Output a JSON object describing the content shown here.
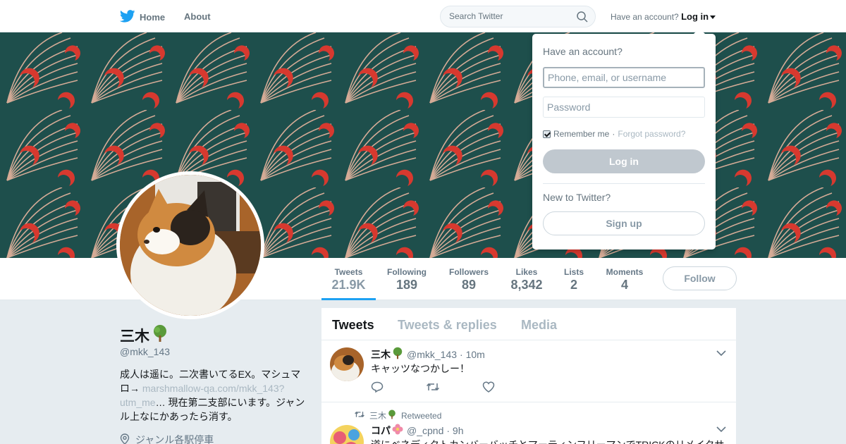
{
  "nav": {
    "home_label": "Home",
    "about_label": "About",
    "search_placeholder": "Search Twitter",
    "have_account": "Have an account?",
    "login_label": "Log in",
    "brand_color": "#1da1f2"
  },
  "profile_nav": {
    "stats": [
      {
        "label": "Tweets",
        "value": "21.9K",
        "active": true
      },
      {
        "label": "Following",
        "value": "189"
      },
      {
        "label": "Followers",
        "value": "89"
      },
      {
        "label": "Likes",
        "value": "8,342"
      },
      {
        "label": "Lists",
        "value": "2"
      },
      {
        "label": "Moments",
        "value": "4"
      }
    ],
    "follow_label": "Follow"
  },
  "profile": {
    "name": "三木",
    "name_emoji": "tree-emoji",
    "handle": "@mkk_143",
    "bio_text_1": "成人は遥に。二次書いてるEX。マシュマロ→ ",
    "bio_link": "marshmallow-qa.com/mkk_143?utm_me",
    "bio_text_2": "… 現在第二支部にいます。ジャンル上なにかあったら消す。",
    "location": "ジャンル各駅停車"
  },
  "timeline": {
    "tabs": [
      "Tweets",
      "Tweets & replies",
      "Media"
    ],
    "tweets": [
      {
        "name": "三木",
        "handle": "@mkk_143",
        "time": "· 10m",
        "text": "キャッツなつかしー！"
      },
      {
        "retweeted_by": "三木",
        "retweeted_label": "Retweeted",
        "name": "コパ",
        "handle": "@_cpnd",
        "time": "· 9h",
        "text": "道にベネディクトカンバーバッチとマーティンフリーマンでTRICKのリメイクサ"
      }
    ]
  },
  "login_dropdown": {
    "title": "Have an account?",
    "username_placeholder": "Phone, email, or username",
    "password_placeholder": "Password",
    "remember_label": "Remember me",
    "separator": "·",
    "forgot_label": "Forgot password?",
    "login_button": "Log in",
    "new_label": "New to Twitter?",
    "signup_button": "Sign up"
  }
}
